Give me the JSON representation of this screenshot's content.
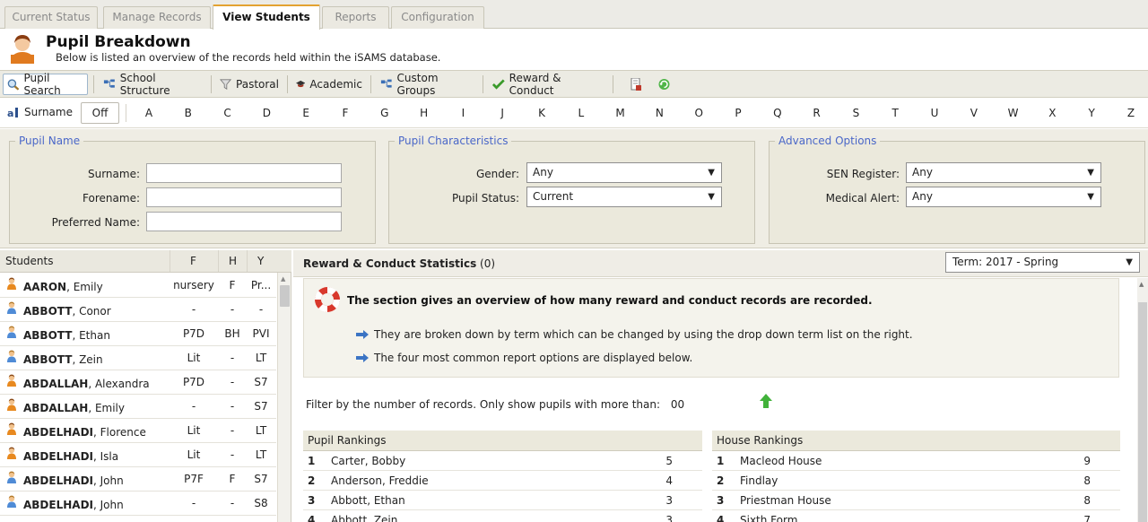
{
  "tabs": [
    {
      "label": "Current Status"
    },
    {
      "label": "Manage Records"
    },
    {
      "label": "View Students"
    },
    {
      "label": "Reports"
    },
    {
      "label": "Configuration"
    }
  ],
  "header": {
    "title": "Pupil Breakdown",
    "subtitle": "Below is listed an overview of the records held within the iSAMS database."
  },
  "toolbar": {
    "pupil_search": "Pupil Search",
    "school_structure": "School Structure",
    "pastoral": "Pastoral",
    "academic": "Academic",
    "custom_groups": "Custom Groups",
    "reward_conduct": "Reward & Conduct"
  },
  "alphabet": {
    "label": "Surname",
    "off": "Off",
    "letters": [
      "A",
      "B",
      "C",
      "D",
      "E",
      "F",
      "G",
      "H",
      "I",
      "J",
      "K",
      "L",
      "M",
      "N",
      "O",
      "P",
      "Q",
      "R",
      "S",
      "T",
      "U",
      "V",
      "W",
      "X",
      "Y",
      "Z"
    ]
  },
  "filters": {
    "pupil_name": {
      "legend": "Pupil Name",
      "surname_label": "Surname:",
      "forename_label": "Forename:",
      "preferred_label": "Preferred Name:"
    },
    "characteristics": {
      "legend": "Pupil Characteristics",
      "gender_label": "Gender:",
      "gender_value": "Any",
      "status_label": "Pupil Status:",
      "status_value": "Current"
    },
    "advanced": {
      "legend": "Advanced Options",
      "sen_label": "SEN Register:",
      "sen_value": "Any",
      "medical_label": "Medical Alert:",
      "medical_value": "Any"
    }
  },
  "students": {
    "headers": {
      "name": "Students",
      "f": "F",
      "h": "H",
      "y": "Y"
    },
    "rows": [
      {
        "surname": "AARON",
        "forename": ", Emily",
        "f": "nursery",
        "h": "F",
        "y": "Pr...",
        "gender": "female"
      },
      {
        "surname": "ABBOTT",
        "forename": ", Conor",
        "f": "-",
        "h": "-",
        "y": "-",
        "gender": "male"
      },
      {
        "surname": "ABBOTT",
        "forename": ", Ethan",
        "f": "P7D",
        "h": "BH",
        "y": "PVI",
        "gender": "male"
      },
      {
        "surname": "ABBOTT",
        "forename": ", Zein",
        "f": "Lit",
        "h": "-",
        "y": "LT",
        "gender": "male"
      },
      {
        "surname": "ABDALLAH",
        "forename": ", Alexandra",
        "f": "P7D",
        "h": "-",
        "y": "S7",
        "gender": "female"
      },
      {
        "surname": "ABDALLAH",
        "forename": ", Emily",
        "f": "-",
        "h": "-",
        "y": "S7",
        "gender": "female"
      },
      {
        "surname": "ABDELHADI",
        "forename": ", Florence",
        "f": "Lit",
        "h": "-",
        "y": "LT",
        "gender": "female"
      },
      {
        "surname": "ABDELHADI",
        "forename": ", Isla",
        "f": "Lit",
        "h": "-",
        "y": "LT",
        "gender": "female"
      },
      {
        "surname": "ABDELHADI",
        "forename": ", John",
        "f": "P7F",
        "h": "F",
        "y": "S7",
        "gender": "male"
      },
      {
        "surname": "ABDELHADI",
        "forename": ", John",
        "f": "-",
        "h": "-",
        "y": "S8",
        "gender": "male"
      }
    ]
  },
  "panel": {
    "title": "Reward & Conduct Statistics",
    "count": "(0)",
    "term": "Term: 2017 - Spring",
    "info_title": "The section gives an overview of how many reward and conduct records are recorded.",
    "bullets": [
      "They are broken down by term which can be changed by using the drop down term list on the right.",
      "The four most common report options are displayed below."
    ],
    "filter_text": "Filter by the number of records. Only show pupils with more than:",
    "filter_value": "00"
  },
  "pupil_rankings": {
    "title": "Pupil Rankings",
    "rows": [
      {
        "rank": "1",
        "name": "Carter, Bobby",
        "value": "5"
      },
      {
        "rank": "2",
        "name": "Anderson, Freddie",
        "value": "4"
      },
      {
        "rank": "3",
        "name": "Abbott, Ethan",
        "value": "3"
      },
      {
        "rank": "4",
        "name": "Abbott, Zein",
        "value": "3"
      }
    ]
  },
  "house_rankings": {
    "title": "House Rankings",
    "rows": [
      {
        "rank": "1",
        "name": "Macleod House",
        "value": "9"
      },
      {
        "rank": "2",
        "name": "Findlay",
        "value": "8"
      },
      {
        "rank": "3",
        "name": "Priestman House",
        "value": "8"
      },
      {
        "rank": "4",
        "name": "Sixth Form",
        "value": "7"
      }
    ]
  }
}
